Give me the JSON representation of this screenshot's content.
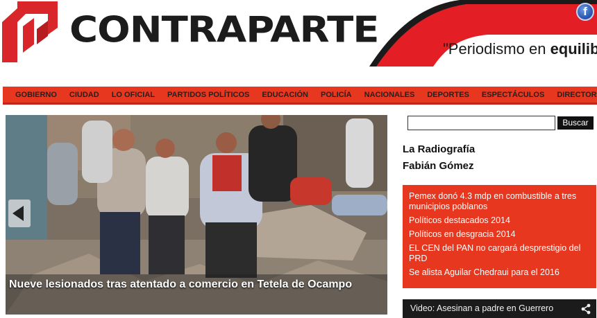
{
  "header": {
    "logo_text": "CONTRAPARTE",
    "slogan_prefix": "\"Periodismo en ",
    "slogan_bold": "equilibr",
    "facebook_icon": "facebook-icon",
    "facebook_glyph": "f",
    "brand_red": "#e8371f",
    "brand_dark": "#1c1c1c"
  },
  "nav": {
    "items": [
      "GOBIERNO",
      "CIUDAD",
      "LO OFICIAL",
      "PARTIDOS POLÍTICOS",
      "EDUCACIÓN",
      "POLICÍA",
      "NACIONALES",
      "DEPORTES",
      "ESPECTÁCULOS",
      "DIRECTORIO"
    ]
  },
  "slider": {
    "caption": "Nueve lesionados tras atentado a comercio en Tetela de Ocampo",
    "prev_icon": "chevron-left-icon"
  },
  "search": {
    "value": "",
    "placeholder": "",
    "button_label": "Buscar"
  },
  "sidebar": {
    "column_titles": [
      "La Radiografía",
      "Fabián Gómez"
    ],
    "headlines": [
      "Pemex donó 4.3 mdp en combustible a tres municipios poblanos",
      "Políticos destacados 2014",
      "Políticos en desgracia 2014",
      "EL CEN del PAN no cargará desprestigio del PRD",
      "Se alista Aguilar Chedraui para el 2016"
    ],
    "video_label": "Video: Asesinan a padre en Guerrero",
    "share_icon": "share-icon"
  }
}
